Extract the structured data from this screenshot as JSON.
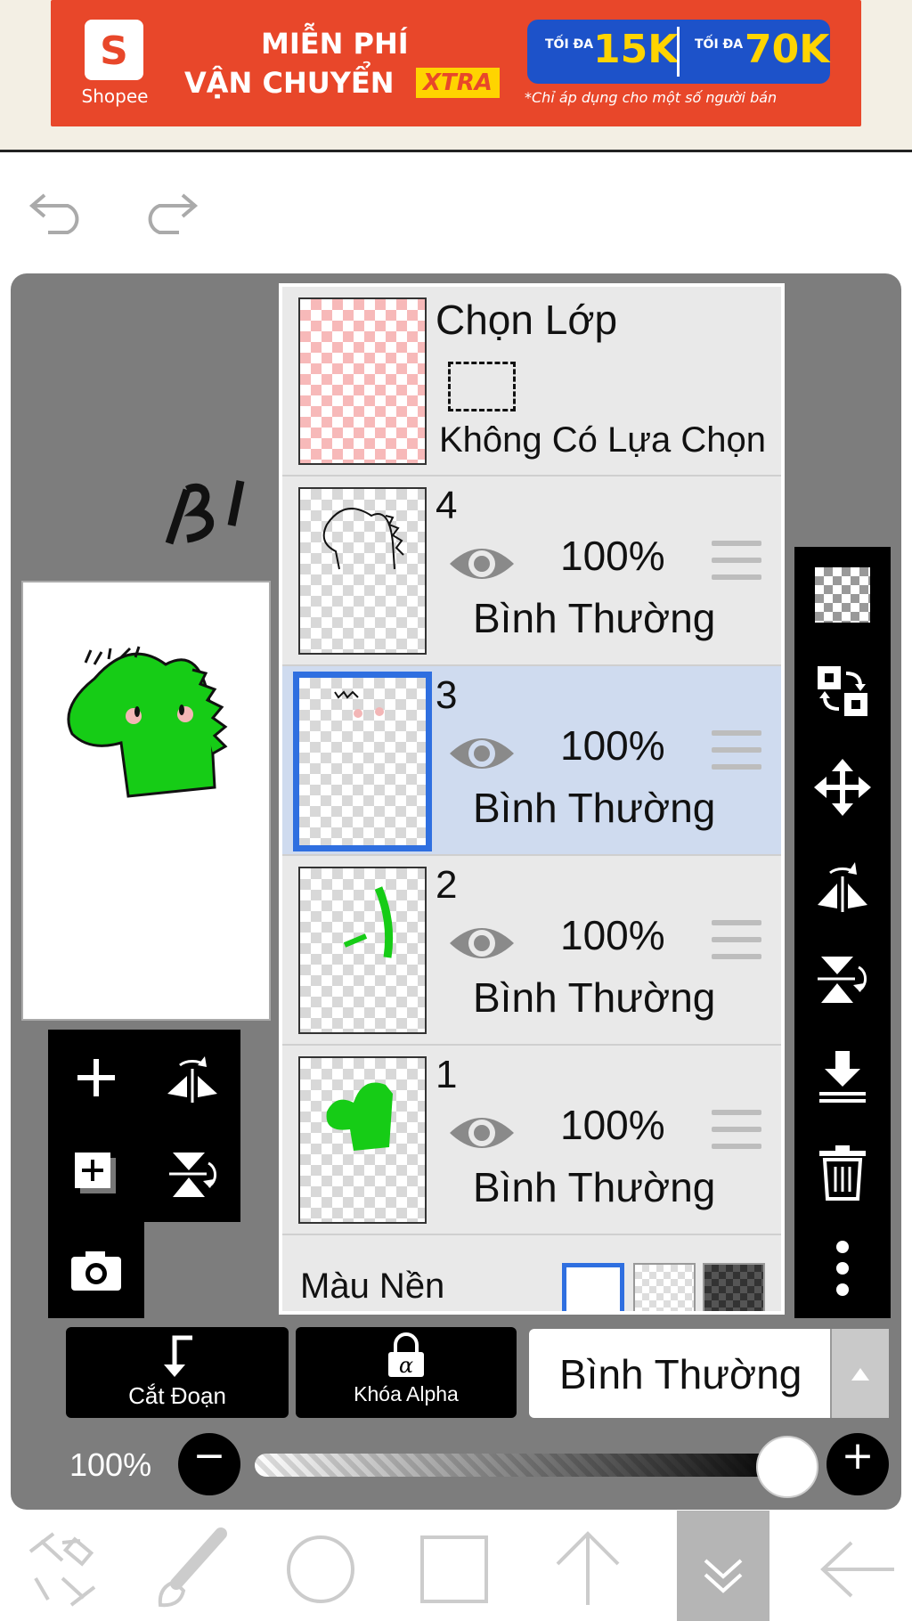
{
  "ad": {
    "brand": "Shopee",
    "headline1": "MIỄN PHÍ",
    "headline2": "VẬN CHUYỂN",
    "xtra": "XTRA",
    "v1_small": "TỐI ĐA",
    "v1_big": "15K",
    "v2_small": "TỐI ĐA",
    "v2_big": "70K",
    "note": "*Chỉ áp dụng cho một số người bán"
  },
  "selection": {
    "title": "Chọn Lớp",
    "subtitle": "Không Có Lựa Chọn"
  },
  "layers": [
    {
      "num": "4",
      "opacity": "100%",
      "blend": "Bình Thường",
      "selected": false
    },
    {
      "num": "3",
      "opacity": "100%",
      "blend": "Bình Thường",
      "selected": true
    },
    {
      "num": "2",
      "opacity": "100%",
      "blend": "Bình Thường",
      "selected": false
    },
    {
      "num": "1",
      "opacity": "100%",
      "blend": "Bình Thường",
      "selected": false
    }
  ],
  "background": {
    "label": "Màu Nền"
  },
  "buttons": {
    "clipping": "Cắt Đoạn",
    "alpha_lock": "Khóa Alpha",
    "blend_mode": "Bình Thường"
  },
  "opacity": {
    "value": "100%",
    "level": 1.0
  },
  "colors": {
    "panel": "#7d7d7d",
    "selected_layer": "#cfdbef",
    "selected_border": "#2f6fe0",
    "ad_bg": "#e8472a",
    "character_green": "#16cc16"
  },
  "icons": {
    "toolbar_left": [
      "plus-icon",
      "flip-horizontal-icon",
      "add-layer-icon",
      "flip-vertical-icon",
      "camera-icon"
    ],
    "toolbar_right": [
      "transparency-icon",
      "transform-icon",
      "move-icon",
      "flip-horizontal-icon",
      "flip-vertical-icon",
      "merge-down-icon",
      "trash-icon",
      "more-icon"
    ],
    "nav": [
      "selection-tool-icon",
      "brush-icon",
      "circle-icon",
      "square-icon",
      "arrow-up-icon",
      "chevron-down-icon",
      "arrow-back-icon"
    ]
  }
}
